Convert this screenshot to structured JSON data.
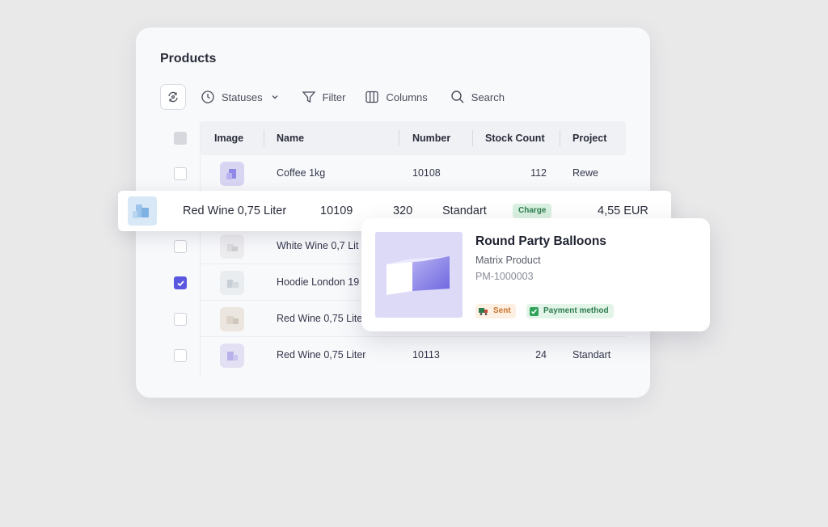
{
  "products": {
    "title": "Products",
    "toolbar": {
      "statuses": "Statuses",
      "filter": "Filter",
      "columns": "Columns",
      "search": "Search"
    },
    "columns": [
      "Image",
      "Name",
      "Number",
      "Stock Count",
      "Project"
    ],
    "rows": [
      {
        "name": "Coffee 1kg",
        "number": "10108",
        "stock": "112",
        "project": "Rewe",
        "checked": false,
        "thumb": "#d8d5f2"
      },
      {
        "name": "White Wine 0,7 Lit",
        "number": "",
        "stock": "",
        "project": "",
        "checked": false,
        "thumb": "#ececef"
      },
      {
        "name": "Hoodie London 19",
        "number": "",
        "stock": "",
        "project": "",
        "checked": true,
        "thumb": "#eaedf0"
      },
      {
        "name": "Red Wine 0,75 Lite",
        "number": "",
        "stock": "",
        "project": "",
        "checked": false,
        "thumb": "#ebe6df"
      },
      {
        "name": "Red Wine 0,75 Liter",
        "number": "10113",
        "stock": "24",
        "project": "Standart",
        "checked": false,
        "thumb": "#e4e0f4"
      }
    ]
  },
  "highlight_row": {
    "name": "Red Wine 0,75 Liter",
    "number": "10109",
    "stock": "320",
    "project": "Standart",
    "badge": "Charge",
    "price": "4,55 EUR"
  },
  "popup": {
    "title": "Round Party Balloons",
    "subtitle": "Matrix Product",
    "code": "PM-1000003",
    "tag_sent": "Sent",
    "tag_payment": "Payment method"
  },
  "colors": {
    "accent": "#5b58e0",
    "charge_bg": "#d9f1e1",
    "sent_color": "#c9742c",
    "payment_color": "#2f7d4f"
  },
  "icons": [
    "sync-icon",
    "clock-icon",
    "chevron-down-icon",
    "filter-icon",
    "columns-icon",
    "search-icon",
    "check-icon",
    "truck-icon",
    "checkbox-icon"
  ]
}
